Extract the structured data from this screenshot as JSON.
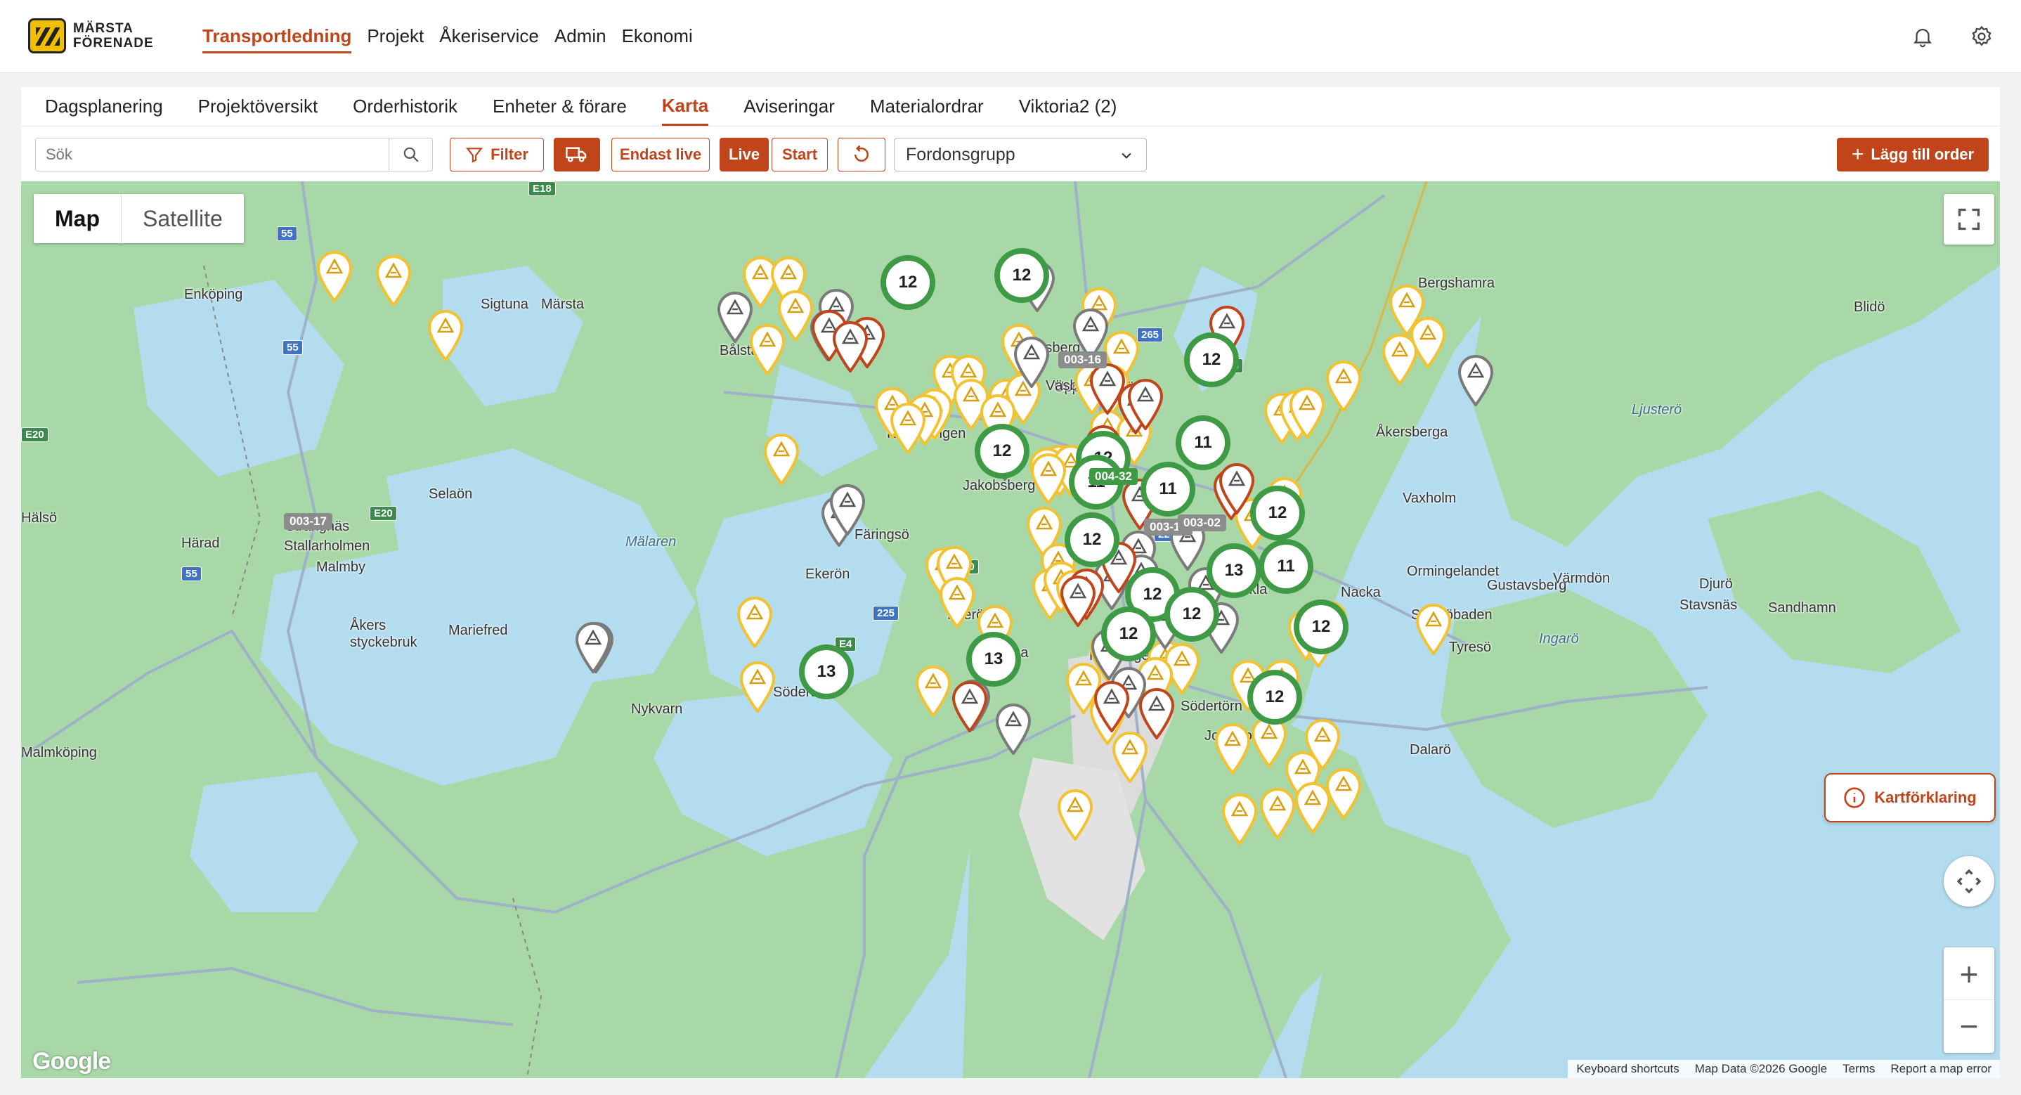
{
  "header": {
    "logo_line1": "MÄRSTA",
    "logo_line2": "FÖRENADE",
    "nav": [
      "Transportledning",
      "Projekt",
      "Åkeriservice",
      "Admin",
      "Ekonomi"
    ],
    "active_nav": "Transportledning"
  },
  "subnav": {
    "tabs": [
      "Dagsplanering",
      "Projektöversikt",
      "Orderhistorik",
      "Enheter & förare",
      "Karta",
      "Aviseringar",
      "Materialordrar",
      "Viktoria2 (2)"
    ],
    "active": "Karta"
  },
  "toolbar": {
    "search_placeholder": "Sök",
    "filter_label": "Filter",
    "only_live_label": "Endast live",
    "live_label": "Live",
    "start_label": "Start",
    "vehicle_group_placeholder": "Fordonsgrupp",
    "add_order_label": "Lägg till order"
  },
  "map": {
    "type_map": "Map",
    "type_satellite": "Satellite",
    "legend_label": "Kartförklaring",
    "attribution": [
      "Keyboard shortcuts",
      "Map Data ©2026 Google",
      "Terms",
      "Report a map error"
    ],
    "google_logo": "Google",
    "places": [
      {
        "name": "Enköping",
        "c": "l"
      },
      {
        "name": "Sigtuna",
        "c": "l"
      },
      {
        "name": "Märsta",
        "c": "l"
      },
      {
        "name": "Bergshamra",
        "c": "l"
      },
      {
        "name": "Blidö",
        "c": "l"
      },
      {
        "name": "Rosersberg",
        "c": "l"
      },
      {
        "name": "Bålsta",
        "c": "l"
      },
      {
        "name": "Upplands Väsby",
        "c": "l"
      },
      {
        "name": "Kungsängen",
        "c": "l"
      },
      {
        "name": "Ljusterö",
        "c": "w"
      },
      {
        "name": "Åkersberga",
        "c": "l"
      },
      {
        "name": "Selaön",
        "c": "l"
      },
      {
        "name": "Jakobsberg",
        "c": "l"
      },
      {
        "name": "Vaxholm",
        "c": "l"
      },
      {
        "name": "Strängnäs",
        "c": "l"
      },
      {
        "name": "Härad",
        "c": "l"
      },
      {
        "name": "Stallarholmen",
        "c": "l"
      },
      {
        "name": "Mälaren",
        "c": "w"
      },
      {
        "name": "Färingsö",
        "c": "l"
      },
      {
        "name": "Malmby",
        "c": "l"
      },
      {
        "name": "Ekerön",
        "c": "l"
      },
      {
        "name": "Ormingelandet",
        "c": "l"
      },
      {
        "name": "Gustavsberg",
        "c": "l"
      },
      {
        "name": "Värmdön",
        "c": "l"
      },
      {
        "name": "Djurö",
        "c": "l"
      },
      {
        "name": "Nacka",
        "c": "l"
      },
      {
        "name": "Sickla",
        "c": "l"
      },
      {
        "name": "Saltsjöbaden",
        "c": "l"
      },
      {
        "name": "Stavsnäs",
        "c": "l"
      },
      {
        "name": "Sandhamn",
        "c": "l"
      },
      {
        "name": "Ekerö",
        "c": "l"
      },
      {
        "name": "Mariefred",
        "c": "l"
      },
      {
        "name": "Åkers styckebruk",
        "c": "l"
      },
      {
        "name": "Tyresö",
        "c": "l"
      },
      {
        "name": "Ingarö",
        "c": "w"
      },
      {
        "name": "Huddinge",
        "c": "l"
      },
      {
        "name": "Tumba",
        "c": "l"
      },
      {
        "name": "Södertälje",
        "c": "l"
      },
      {
        "name": "Nykvarn",
        "c": "l"
      },
      {
        "name": "Södertörn",
        "c": "l"
      },
      {
        "name": "Jordbro",
        "c": "l"
      },
      {
        "name": "Dalarö",
        "c": "l"
      },
      {
        "name": "Malmköping",
        "c": "l"
      },
      {
        "name": "Hälsö",
        "c": "l"
      },
      {
        "name": "Väsby",
        "c": "l"
      }
    ],
    "road_shields": [
      "E18",
      "55",
      "55",
      "E20",
      "E20",
      "55",
      "265",
      "E18",
      "E4",
      "225",
      "E4",
      "E20",
      "226"
    ],
    "clusters": [
      "12",
      "12",
      "12",
      "12",
      "12",
      "11",
      "11",
      "11",
      "12",
      "12",
      "11",
      "13",
      "12",
      "12",
      "13",
      "12",
      "13",
      "12",
      "12"
    ],
    "vehicle_tags": [
      "003-16",
      "004-32",
      "003-14",
      "003-02",
      "003-17"
    ],
    "colors": {
      "accent": "#c0451a",
      "cluster": "#3f9a45",
      "pin_yellow": "#f2c230",
      "pin_grey": "#7a7a7a",
      "pin_red": "#c0451a",
      "vehicle_green": "#3f9a45",
      "water": "#b4dcef",
      "land": "#a8d8a7"
    }
  }
}
